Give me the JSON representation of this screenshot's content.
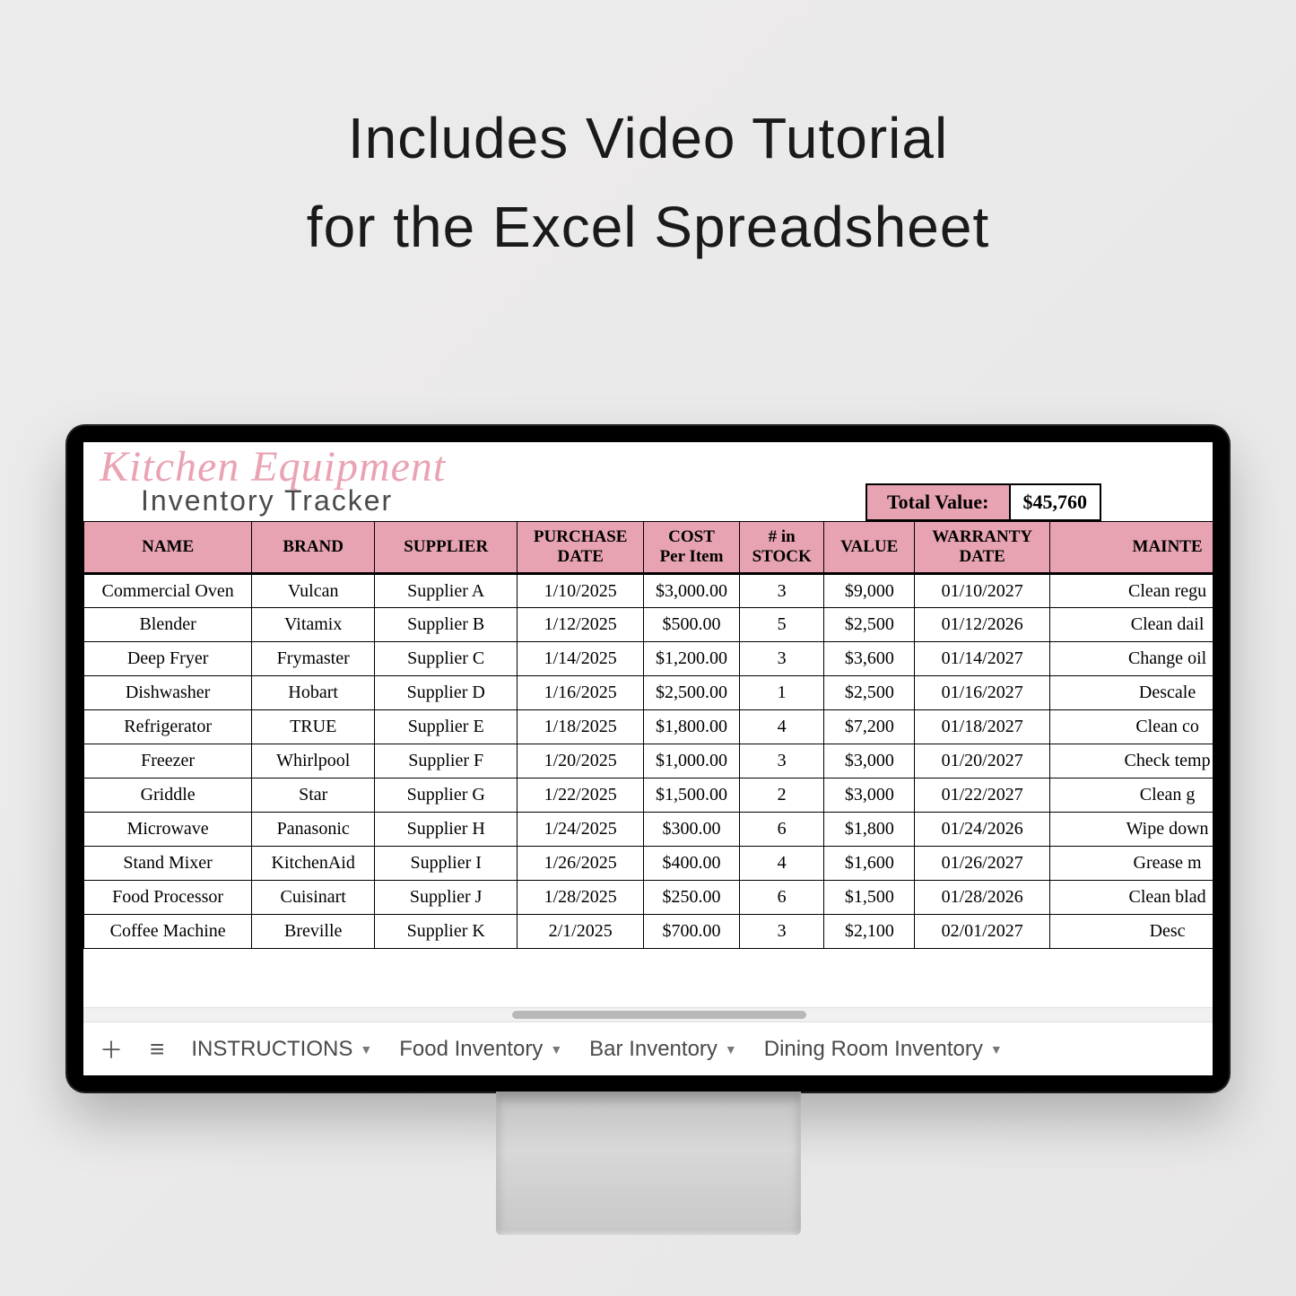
{
  "heading": {
    "line1": "Includes Video Tutorial",
    "line2": "for the Excel Spreadsheet"
  },
  "sheet": {
    "script_title": "Kitchen Equipment",
    "sub_title": "Inventory Tracker",
    "total_label": "Total Value:",
    "total_value": "$45,760"
  },
  "columns": [
    "NAME",
    "BRAND",
    "SUPPLIER",
    "PURCHASE DATE",
    "COST Per Item",
    "# in STOCK",
    "VALUE",
    "WARRANTY DATE",
    "MAINTE"
  ],
  "rows": [
    {
      "name": "Commercial Oven",
      "brand": "Vulcan",
      "supplier": "Supplier A",
      "pdate": "1/10/2025",
      "cost": "$3,000.00",
      "stock": "3",
      "value": "$9,000",
      "warranty": "01/10/2027",
      "maint": "Clean regu"
    },
    {
      "name": "Blender",
      "brand": "Vitamix",
      "supplier": "Supplier B",
      "pdate": "1/12/2025",
      "cost": "$500.00",
      "stock": "5",
      "value": "$2,500",
      "warranty": "01/12/2026",
      "maint": "Clean dail"
    },
    {
      "name": "Deep Fryer",
      "brand": "Frymaster",
      "supplier": "Supplier C",
      "pdate": "1/14/2025",
      "cost": "$1,200.00",
      "stock": "3",
      "value": "$3,600",
      "warranty": "01/14/2027",
      "maint": "Change oil"
    },
    {
      "name": "Dishwasher",
      "brand": "Hobart",
      "supplier": "Supplier D",
      "pdate": "1/16/2025",
      "cost": "$2,500.00",
      "stock": "1",
      "value": "$2,500",
      "warranty": "01/16/2027",
      "maint": "Descale"
    },
    {
      "name": "Refrigerator",
      "brand": "TRUE",
      "supplier": "Supplier E",
      "pdate": "1/18/2025",
      "cost": "$1,800.00",
      "stock": "4",
      "value": "$7,200",
      "warranty": "01/18/2027",
      "maint": "Clean co"
    },
    {
      "name": "Freezer",
      "brand": "Whirlpool",
      "supplier": "Supplier F",
      "pdate": "1/20/2025",
      "cost": "$1,000.00",
      "stock": "3",
      "value": "$3,000",
      "warranty": "01/20/2027",
      "maint": "Check temp"
    },
    {
      "name": "Griddle",
      "brand": "Star",
      "supplier": "Supplier G",
      "pdate": "1/22/2025",
      "cost": "$1,500.00",
      "stock": "2",
      "value": "$3,000",
      "warranty": "01/22/2027",
      "maint": "Clean g"
    },
    {
      "name": "Microwave",
      "brand": "Panasonic",
      "supplier": "Supplier H",
      "pdate": "1/24/2025",
      "cost": "$300.00",
      "stock": "6",
      "value": "$1,800",
      "warranty": "01/24/2026",
      "maint": "Wipe down"
    },
    {
      "name": "Stand Mixer",
      "brand": "KitchenAid",
      "supplier": "Supplier I",
      "pdate": "1/26/2025",
      "cost": "$400.00",
      "stock": "4",
      "value": "$1,600",
      "warranty": "01/26/2027",
      "maint": "Grease m"
    },
    {
      "name": "Food Processor",
      "brand": "Cuisinart",
      "supplier": "Supplier J",
      "pdate": "1/28/2025",
      "cost": "$250.00",
      "stock": "6",
      "value": "$1,500",
      "warranty": "01/28/2026",
      "maint": "Clean blad"
    },
    {
      "name": "Coffee Machine",
      "brand": "Breville",
      "supplier": "Supplier K",
      "pdate": "2/1/2025",
      "cost": "$700.00",
      "stock": "3",
      "value": "$2,100",
      "warranty": "02/01/2027",
      "maint": "Desc"
    }
  ],
  "tabs": {
    "t0": "INSTRUCTIONS",
    "t1": "Food Inventory",
    "t2": "Bar Inventory",
    "t3": "Dining Room Inventory"
  }
}
